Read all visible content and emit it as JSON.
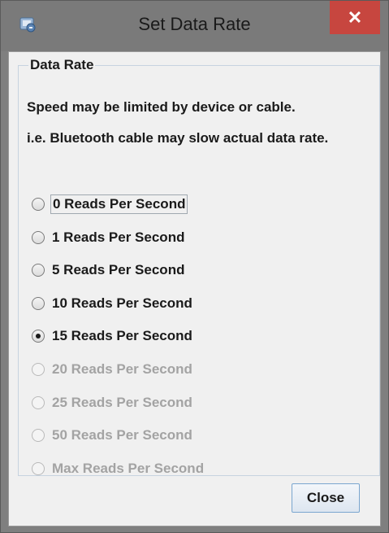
{
  "window": {
    "title": "Set Data Rate",
    "close_glyph": "✕",
    "app_icon": "app-icon"
  },
  "group": {
    "legend": "Data Rate",
    "info_line_1": "Speed may be limited by device or cable.",
    "info_line_2": "i.e. Bluetooth cable may slow actual data rate."
  },
  "options": [
    {
      "label": "0 Reads Per Second",
      "checked": false,
      "enabled": true,
      "focused": true
    },
    {
      "label": "1 Reads Per Second",
      "checked": false,
      "enabled": true,
      "focused": false
    },
    {
      "label": "5 Reads Per Second",
      "checked": false,
      "enabled": true,
      "focused": false
    },
    {
      "label": "10 Reads Per Second",
      "checked": false,
      "enabled": true,
      "focused": false
    },
    {
      "label": "15 Reads Per Second",
      "checked": true,
      "enabled": true,
      "focused": false
    },
    {
      "label": "20 Reads Per Second",
      "checked": false,
      "enabled": false,
      "focused": false
    },
    {
      "label": "25 Reads Per Second",
      "checked": false,
      "enabled": false,
      "focused": false
    },
    {
      "label": "50 Reads Per Second",
      "checked": false,
      "enabled": false,
      "focused": false
    },
    {
      "label": "Max Reads Per Second",
      "checked": false,
      "enabled": false,
      "focused": false
    }
  ],
  "buttons": {
    "close_label": "Close"
  }
}
